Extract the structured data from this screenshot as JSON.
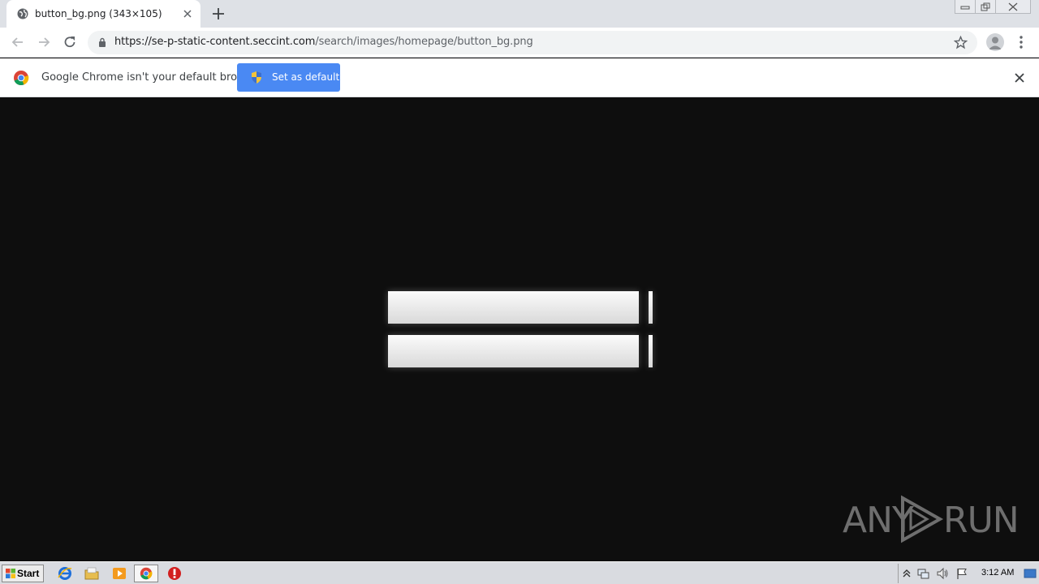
{
  "tab": {
    "title": "button_bg.png (343×105)"
  },
  "address_bar": {
    "url_host": "https://se-p-static-content.seccint.com",
    "url_path": "/search/images/homepage/button_bg.png"
  },
  "infobar": {
    "message": "Google Chrome isn't your default browser",
    "button_label": "Set as default"
  },
  "content": {
    "image_name": "button_bg.png",
    "watermark_left": "ANY",
    "watermark_right": "RUN"
  },
  "taskbar": {
    "start_label": "Start",
    "clock": "3:12 AM"
  },
  "colors": {
    "tabstrip": "#dee1e6",
    "infobar_button": "#4a89f3",
    "page_background": "#0e0e0e"
  }
}
